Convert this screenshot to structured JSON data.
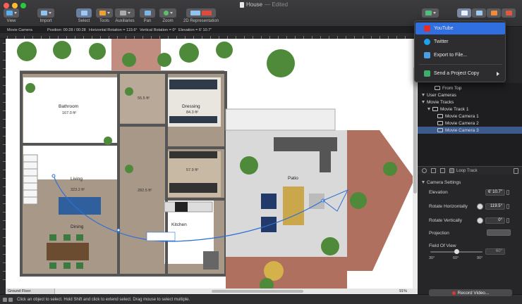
{
  "window": {
    "title": "House",
    "subtitle": "— Edited"
  },
  "toolbar": {
    "view": "View",
    "import": "Import",
    "select": "Select",
    "tools": "Tools",
    "auxiliaries": "Auxiliaries",
    "pan": "Pan",
    "zoom": "Zoom",
    "representation": "2D Representation"
  },
  "infobar": {
    "camera": "Movie Camera",
    "position": "Position: 00:28 / 00:28",
    "horizontal": "Horizontal Rotation = 119.6°",
    "vertical": "Vertical Rotation = 0°",
    "elevation": "Elevation = 6' 10.7\""
  },
  "rooms": [
    {
      "name": "Bathroom",
      "area": "167.0 ft²"
    },
    {
      "name": "",
      "area": "55.5 ft²"
    },
    {
      "name": "Dressing",
      "area": "84.3 ft²"
    },
    {
      "name": "",
      "area": "57.9 ft²"
    },
    {
      "name": "Living",
      "area": "323.2 ft²"
    },
    {
      "name": "",
      "area": "282.5 ft²"
    },
    {
      "name": "Patio",
      "area": ""
    },
    {
      "name": "Dining",
      "area": ""
    },
    {
      "name": "Kitchen",
      "area": ""
    }
  ],
  "canvas": {
    "floor": "Ground Floor",
    "zoom": "91%"
  },
  "status": {
    "message": "Click an object to select. Hold Shift and click to extend select. Drag mouse to select multiple."
  },
  "share_menu": {
    "items": [
      {
        "label": "YouTube",
        "icon": "youtube-icon",
        "color": "#e52d27"
      },
      {
        "label": "Twitter",
        "icon": "twitter-icon",
        "color": "#1da1f2"
      },
      {
        "label": "Export to File...",
        "icon": "folder-icon",
        "color": "#4a9fe8"
      },
      {
        "label": "Send a Project Copy",
        "icon": "send-copy-icon",
        "color": "#3fae6a"
      }
    ]
  },
  "tree": {
    "items": [
      {
        "label": "From Top",
        "type": "camera"
      },
      {
        "label": "User Cameras",
        "type": "group"
      },
      {
        "label": "Movie Tracks",
        "type": "group"
      },
      {
        "label": "Movie Track 1",
        "type": "track"
      },
      {
        "label": "Movie Camera 1",
        "type": "camera"
      },
      {
        "label": "Movie Camera 2",
        "type": "camera"
      },
      {
        "label": "Movie Camera 3",
        "type": "camera",
        "selected": true
      }
    ],
    "loop_track": "Loop Track"
  },
  "camera_settings": {
    "header": "Camera Settings",
    "elevation_label": "Elevation",
    "elevation_value": "6' 10.7\"",
    "rot_h_label": "Rotate Horizontally",
    "rot_h_value": "119.5°",
    "rot_v_label": "Rotate Vertically",
    "rot_v_value": "0°",
    "projection_label": "Projection",
    "fov_label": "Field Of View",
    "fov_value": "60°",
    "fov_min": "30°",
    "fov_mid": "60°",
    "fov_max": "90°",
    "record": "Record Video..."
  }
}
